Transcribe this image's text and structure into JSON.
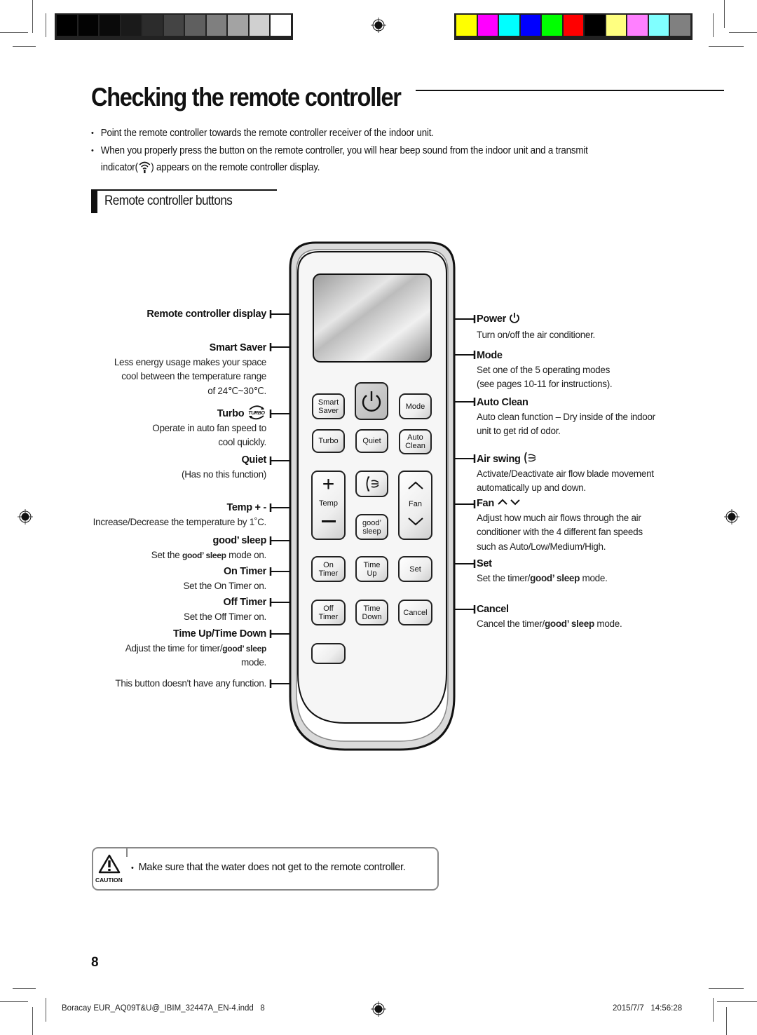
{
  "print_marks": {
    "gray_scale": [
      "#000000",
      "#030303",
      "#0a0a0a",
      "#1a1a1a",
      "#2c2c2c",
      "#444444",
      "#5f5f5f",
      "#7f7f7f",
      "#a3a3a3",
      "#d0d0d0",
      "#ffffff"
    ],
    "color_scale": [
      "#ffff00",
      "#ff00ff",
      "#00ffff",
      "#0000ff",
      "#00ff00",
      "#ff0000",
      "#000000",
      "#ffff80",
      "#ff80ff",
      "#80ffff",
      "#808080"
    ]
  },
  "page": {
    "title": "Checking the remote controller",
    "bullets": [
      "Point the remote controller towards the remote controller receiver of the indoor unit.",
      "When you properly press the button on the remote controller, you will hear beep sound from the indoor unit and a transmit",
      "indicator(",
      ") appears on the remote controller display."
    ],
    "transmit_icon": "wifi-transmit-icon",
    "section_title": "Remote controller buttons"
  },
  "left_labels": [
    {
      "title": "Remote controller display",
      "desc": []
    },
    {
      "title": "Smart Saver",
      "desc": [
        "Less energy usage makes your space",
        "cool between the temperature range",
        "of 24℃~30℃."
      ]
    },
    {
      "title": "Turbo",
      "icon": "turbo-icon",
      "icon_text": "TURBO",
      "desc": [
        "Operate in auto fan speed to",
        "cool quickly."
      ]
    },
    {
      "title": "Quiet",
      "desc": [
        "(Has no this function)"
      ]
    },
    {
      "title": "Temp + -",
      "desc": [
        "Increase/Decrease the temperature by 1˚C."
      ]
    },
    {
      "title": "good’ sleep",
      "desc_pre": "Set the ",
      "desc_bold": "good’ sleep",
      "desc_post": " mode on."
    },
    {
      "title": "On Timer",
      "desc": [
        "Set the On Timer on."
      ]
    },
    {
      "title": "Off Timer",
      "desc": [
        "Set the Off Timer on."
      ]
    },
    {
      "title": "Time Up/Time Down",
      "desc_pre": "Adjust the time for timer/",
      "desc_bold": "good’ sleep",
      "desc_post": "mode."
    },
    {
      "title": "",
      "desc": [
        "This button doesn't have any function."
      ]
    }
  ],
  "right_labels": [
    {
      "title": "Power",
      "icon": "power-icon",
      "desc": [
        "Turn on/off the air conditioner."
      ]
    },
    {
      "title": "Mode",
      "desc": [
        "Set one of the 5 operating modes",
        "(see pages 10-11 for instructions)."
      ]
    },
    {
      "title": "Auto Clean",
      "desc": [
        "Auto clean function – Dry inside of the indoor",
        "unit to get rid of odor."
      ]
    },
    {
      "title": "Air swing",
      "icon": "air-swing-icon",
      "desc": [
        "Activate/Deactivate air flow blade movement",
        "automatically up and down."
      ]
    },
    {
      "title": "Fan",
      "icon": "fan-up-down-icon",
      "desc": [
        "Adjust how much air flows through the air",
        "conditioner with the 4 different fan speeds",
        "such as Auto/Low/Medium/High."
      ]
    },
    {
      "title": "Set",
      "desc_pre": "Set the timer/",
      "desc_bold": "good’ sleep",
      "desc_post": " mode."
    },
    {
      "title": "Cancel",
      "desc_pre": "Cancel the timer/",
      "desc_bold": "good’ sleep",
      "desc_post": " mode."
    }
  ],
  "remote_buttons": {
    "smart_saver": [
      "Smart",
      "Saver"
    ],
    "mode": "Mode",
    "turbo": "Turbo",
    "quiet": "Quiet",
    "auto_clean": [
      "Auto",
      "Clean"
    ],
    "temp": "Temp",
    "fan": "Fan",
    "good_sleep": [
      "good’",
      "sleep"
    ],
    "on_timer": [
      "On",
      "Timer"
    ],
    "time_up": [
      "Time",
      "Up"
    ],
    "set": "Set",
    "off_timer": [
      "Off",
      "Timer"
    ],
    "time_down": [
      "Time",
      "Down"
    ],
    "cancel": "Cancel"
  },
  "caution": {
    "label": "CAUTION",
    "text": "Make sure that the water does not get to the remote controller."
  },
  "page_number": "8",
  "footer": {
    "file": "Boracay EUR_AQ09T&U@_IBIM_32447A_EN-4.indd   8",
    "date": "2015/7/7   14:56:28"
  }
}
